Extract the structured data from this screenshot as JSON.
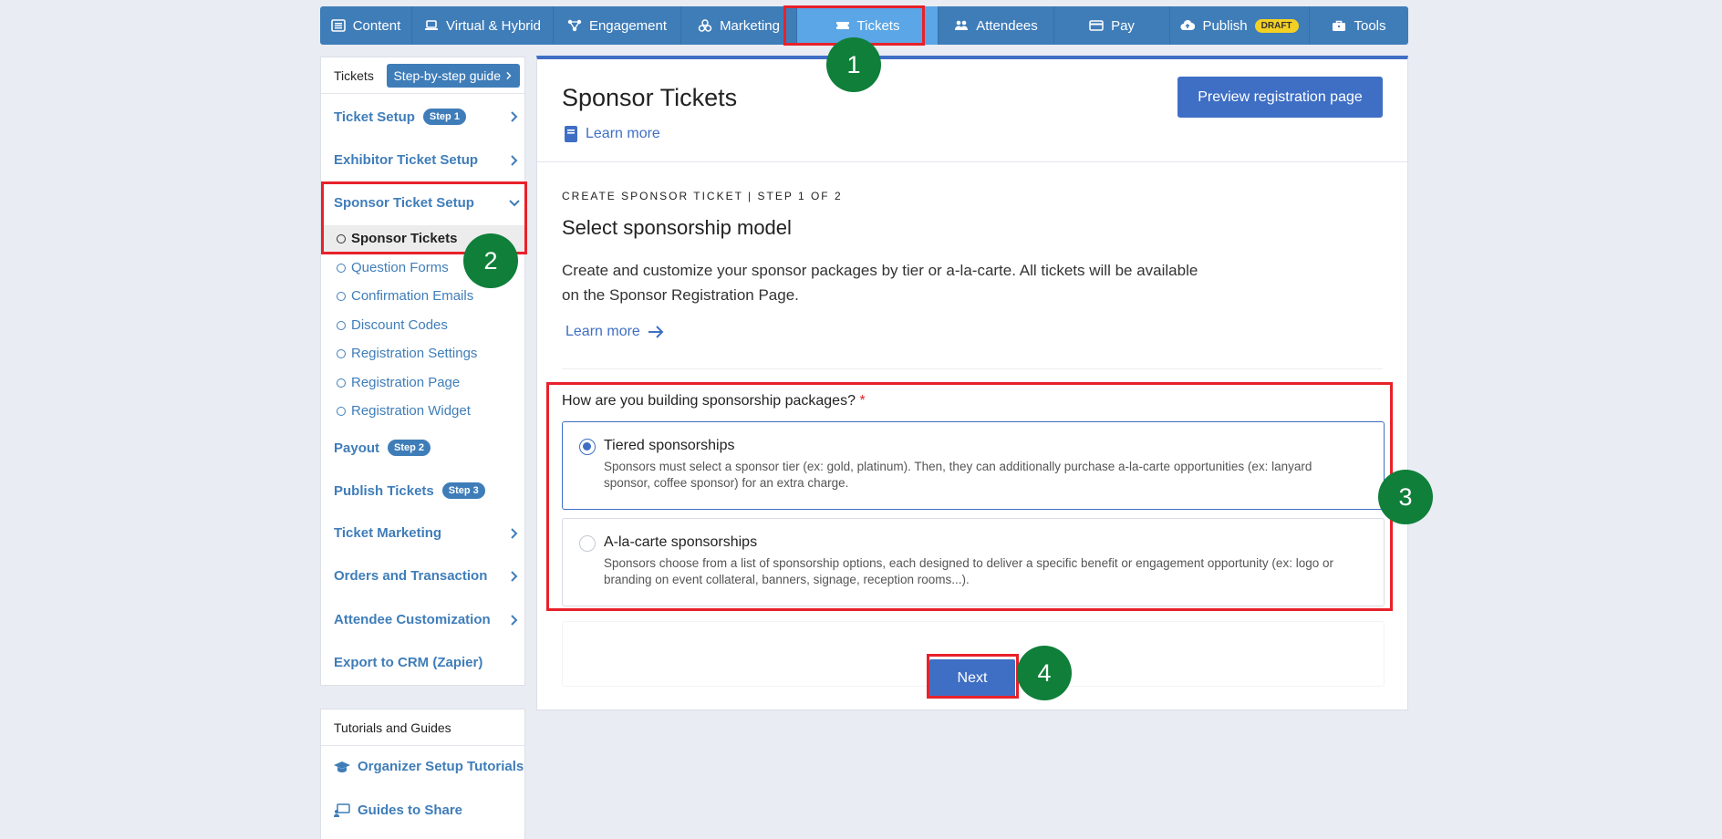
{
  "nav": {
    "tabs": [
      {
        "label": "Content",
        "icon": "list-icon"
      },
      {
        "label": "Virtual & Hybrid",
        "icon": "laptop-icon"
      },
      {
        "label": "Engagement",
        "icon": "network-icon"
      },
      {
        "label": "Marketing",
        "icon": "megaphone-icon"
      },
      {
        "label": "Tickets",
        "icon": "ticket-icon",
        "active": true
      },
      {
        "label": "Attendees",
        "icon": "users-icon"
      },
      {
        "label": "Pay",
        "icon": "credit-card-icon"
      },
      {
        "label": "Publish",
        "icon": "cloud-upload-icon",
        "badge": "DRAFT"
      },
      {
        "label": "Tools",
        "icon": "briefcase-icon"
      }
    ]
  },
  "sidebar": {
    "header": "Tickets",
    "guide_button": "Step-by-step guide",
    "items": [
      {
        "label": "Ticket Setup",
        "step": "Step 1"
      },
      {
        "label": "Exhibitor Ticket Setup"
      },
      {
        "label": "Sponsor Ticket Setup"
      },
      {
        "label": "Payout",
        "step": "Step 2"
      },
      {
        "label": "Publish Tickets",
        "step": "Step 3"
      },
      {
        "label": "Ticket Marketing"
      },
      {
        "label": "Orders and Transaction"
      },
      {
        "label": "Attendee Customization"
      },
      {
        "label": "Export to CRM (Zapier)"
      }
    ],
    "subitems": [
      "Sponsor Tickets",
      "Question Forms",
      "Confirmation Emails",
      "Discount Codes",
      "Registration Settings",
      "Registration Page",
      "Registration Widget"
    ]
  },
  "tutorials": {
    "header": "Tutorials and Guides",
    "items": [
      "Organizer Setup Tutorials",
      "Guides to Share"
    ]
  },
  "main": {
    "title": "Sponsor Tickets",
    "learn_more_top": "Learn more",
    "preview_button": "Preview registration page",
    "eyebrow": "CREATE SPONSOR TICKET | STEP 1 OF 2",
    "section_title": "Select sponsorship model",
    "description": "Create and customize your sponsor packages by tier or a-la-carte. All tickets will be available on the Sponsor Registration Page.",
    "learn_more": "Learn more",
    "question": "How are you building sponsorship packages?",
    "required_mark": "*",
    "options": [
      {
        "title": "Tiered sponsorships",
        "desc": "Sponsors must select a sponsor tier (ex: gold, platinum). Then, they can additionally purchase a-la-carte opportunities (ex: lanyard sponsor, coffee sponsor) for an extra charge.",
        "selected": true
      },
      {
        "title": "A-la-carte sponsorships",
        "desc": "Sponsors choose from a list of sponsorship options, each designed to deliver a specific benefit or engagement opportunity (ex: logo or branding on event collateral, banners, signage, reception rooms...).",
        "selected": false
      }
    ],
    "next_button": "Next"
  },
  "callouts": [
    "1",
    "2",
    "3",
    "4"
  ],
  "colors": {
    "nav_bg": "#3f7db9",
    "nav_active": "#5aa6e6",
    "primary": "#3f6fc4",
    "highlight": "#e8212a",
    "callout": "#0f7f3a",
    "draft_badge": "#f2d024"
  }
}
